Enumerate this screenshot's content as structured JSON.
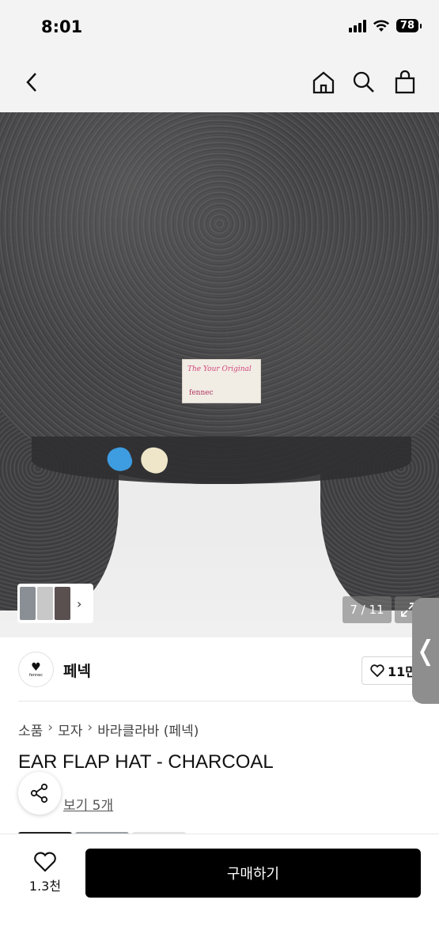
{
  "status_bar": {
    "time": "8:01",
    "battery": "78"
  },
  "nav": {
    "back_icon": "chevron-left-icon",
    "home_icon": "home-icon",
    "search_icon": "search-icon",
    "bag_icon": "shopping-bag-icon"
  },
  "gallery": {
    "counter": "7 / 11",
    "label_script": "The Your Original",
    "label_brand": "fennec"
  },
  "shop": {
    "name": "페넥",
    "logo_text": "fennec",
    "likes": "11만"
  },
  "breadcrumb": [
    "소품",
    "모자",
    "바라클라바 (페넥)"
  ],
  "product": {
    "title": "EAR FLAP HAT - CHARCOAL",
    "review_text": "후기 5개",
    "review_visible": "보기 5개"
  },
  "bottom": {
    "wish_count": "1.3천",
    "buy_label": "구매하기"
  },
  "colors": {
    "buy_button": "#000000",
    "side_tab": "#8e8e8e"
  }
}
